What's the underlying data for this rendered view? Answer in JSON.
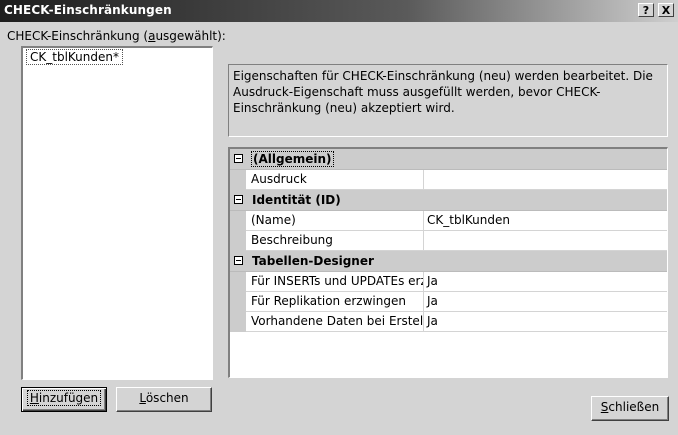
{
  "window": {
    "title": "CHECK-Einschränkungen",
    "help_button": "?",
    "close_button": "X"
  },
  "constraint_list": {
    "label_prefix": "CHECK-Einschränkung (",
    "label_accel": "a",
    "label_rest": "usgewählt):",
    "items": [
      "CK_tblKunden*"
    ]
  },
  "description": "Eigenschaften für CHECK-Einschränkung (neu) werden bearbeitet.  Die Ausdruck-Eigenschaft muss ausgefüllt werden, bevor CHECK-Einschränkung (neu) akzeptiert wird.",
  "property_grid": {
    "categories": [
      {
        "label": "(Allgemein)",
        "properties": [
          {
            "name": "Ausdruck",
            "value": ""
          }
        ]
      },
      {
        "label": "Identität (ID)",
        "properties": [
          {
            "name": "(Name)",
            "value": "CK_tblKunden"
          },
          {
            "name": "Beschreibung",
            "value": ""
          }
        ]
      },
      {
        "label": "Tabellen-Designer",
        "properties": [
          {
            "name": "Für INSERTs und UPDATEs erzwingen",
            "value": "Ja"
          },
          {
            "name": "Für Replikation erzwingen",
            "value": "Ja"
          },
          {
            "name": "Vorhandene Daten bei Erstellung oder erneuter Aktivierung überprüfen",
            "value": "Ja"
          }
        ]
      }
    ]
  },
  "buttons": {
    "add_accel": "H",
    "add_rest": "inzufügen",
    "delete_accel": "L",
    "delete_rest": "öschen",
    "close_accel": "S",
    "close_rest": "chließen"
  },
  "colors": {
    "dialog_bg": "#d4d4d4",
    "title_bar": "#1e1e1e",
    "grid_category_bg": "#cccccc"
  }
}
